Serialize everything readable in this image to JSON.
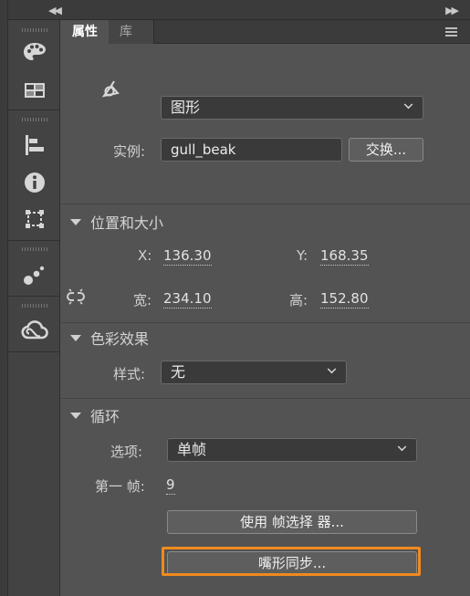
{
  "panel": {
    "tabs": [
      {
        "label": "属性",
        "active": true
      },
      {
        "label": "库",
        "active": false
      }
    ]
  },
  "instance": {
    "type_value": "图形",
    "name_label": "实例:",
    "name_value": "gull_beak",
    "swap_button": "交换..."
  },
  "position_size": {
    "header": "位置和大小",
    "x_label": "X:",
    "x_value": "136.30",
    "y_label": "Y:",
    "y_value": "168.35",
    "width_label": "宽:",
    "width_value": "234.10",
    "height_label": "高:",
    "height_value": "152.80"
  },
  "color_effect": {
    "header": "色彩效果",
    "style_label": "样式:",
    "style_value": "无"
  },
  "looping": {
    "header": "循环",
    "options_label": "选项:",
    "options_value": "单帧",
    "first_frame_label": "第一 帧:",
    "first_frame_value": "9",
    "frame_picker_button": "使用 帧选择 器...",
    "lip_sync_button": "嘴形同步..."
  },
  "colors": {
    "highlight": "#f08a1e",
    "panel_bg": "#535353",
    "toolbar_bg": "#434343"
  },
  "icons": [
    "collapse-left-icon",
    "collapse-right-icon",
    "palette-icon",
    "swatches-icon",
    "align-icon",
    "info-icon",
    "transform-icon",
    "motion-presets-icon",
    "creative-cloud-icon",
    "panel-menu-icon",
    "graphic-symbol-icon",
    "link-proportions-icon"
  ]
}
